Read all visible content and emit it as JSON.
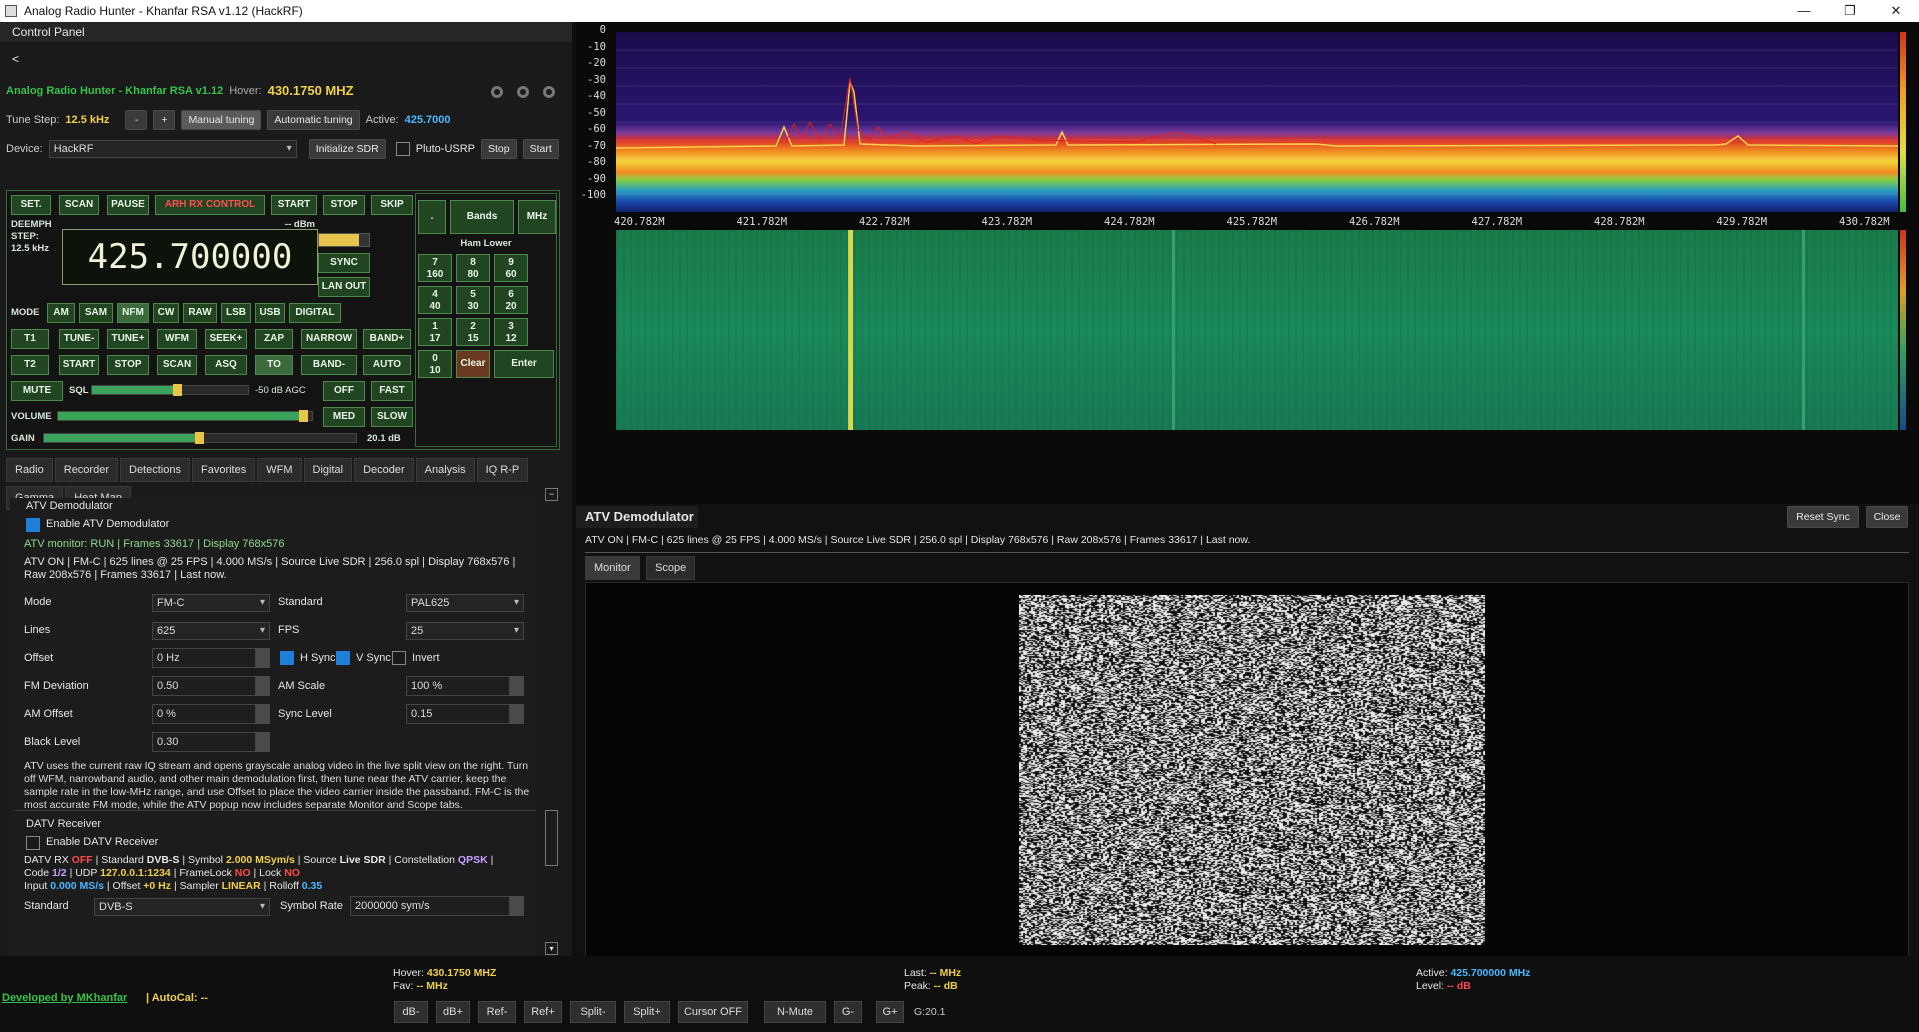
{
  "window": {
    "title": "Analog Radio Hunter - Khanfar RSA v1.12 (HackRF)",
    "minimize": "—",
    "maximize": "❐",
    "close": "✕"
  },
  "control_panel": {
    "title": "Control Panel",
    "collapse": "<",
    "app_name": "Analog Radio Hunter - Khanfar RSA v1.12",
    "hover_label": "Hover:",
    "hover_value": "430.1750 MHZ",
    "tune_step_label": "Tune Step:",
    "tune_step_value": "12.5 kHz",
    "minus": "-",
    "plus": "+",
    "manual_tuning": "Manual tuning",
    "automatic_tuning": "Automatic tuning",
    "active_label": "Active:",
    "active_value": "425.7000",
    "device_label": "Device:",
    "device_value": "HackRF",
    "init_sdr": "Initialize SDR",
    "pluto": "Pluto-USRP",
    "stop": "Stop",
    "start": "Start"
  },
  "arh": {
    "top_buttons": [
      "SET.",
      "SCAN",
      "PAUSE",
      "ARH RX CONTROL",
      "START",
      "STOP",
      "SKIP"
    ],
    "deemph": "DEEMPH",
    "step": "STEP:",
    "step_val": "12.5 kHz",
    "dbm": "-- dBm",
    "frequency": "425.700000",
    "sync": "SYNC",
    "lan_out": "LAN OUT",
    "mode_label": "MODE",
    "modes": [
      "AM",
      "SAM",
      "NFM",
      "CW",
      "RAW",
      "LSB",
      "USB",
      "DIGITAL"
    ],
    "row1": [
      "T1",
      "TUNE-",
      "TUNE+",
      "WFM",
      "SEEK+",
      "ZAP",
      "NARROW",
      "BAND+"
    ],
    "row2": [
      "T2",
      "START",
      "STOP",
      "SCAN",
      "ASQ",
      "TO",
      "BAND-",
      "AUTO"
    ],
    "mute": "MUTE",
    "sql": "SQL",
    "sql_value": "-50 dB AGC",
    "sql_level": 0.55,
    "off": "OFF",
    "fast": "FAST",
    "volume": "VOLUME",
    "volume_level": 0.97,
    "med": "MED",
    "slow": "SLOW",
    "gain": "GAIN",
    "gain_level": 0.5,
    "gain_value": "20.1 dB",
    "keypad": {
      "dot": ".",
      "bands": "Bands",
      "mhz": "MHz",
      "band_name": "Ham Lower",
      "keys": [
        [
          "7",
          "160"
        ],
        [
          "8",
          "80"
        ],
        [
          "9",
          "60"
        ],
        [
          "4",
          "40"
        ],
        [
          "5",
          "30"
        ],
        [
          "6",
          "20"
        ],
        [
          "1",
          "17"
        ],
        [
          "2",
          "15"
        ],
        [
          "3",
          "12"
        ],
        [
          "0",
          "10"
        ]
      ],
      "clear": "Clear",
      "enter": "Enter"
    }
  },
  "tabs": [
    "Radio",
    "Recorder",
    "Detections",
    "Favorites",
    "WFM",
    "Digital",
    "Decoder",
    "Analysis",
    "IQ R-P",
    "Gamma",
    "Heat Map"
  ],
  "atv_panel": {
    "group": "ATV Demodulator",
    "enable": "Enable ATV Demodulator",
    "monitor": "ATV monitor: RUN | Frames 33617 | Display 768x576",
    "status": "ATV ON | FM-C | 625 lines @ 25 FPS | 4.000 MS/s | Source Live SDR | 256.0 spl | Display 768x576 | Raw 208x576 | Frames 33617 | Last now.",
    "mode_label": "Mode",
    "mode_value": "FM-C",
    "standard_label": "Standard",
    "standard_value": "PAL625",
    "lines_label": "Lines",
    "lines_value": "625",
    "fps_label": "FPS",
    "fps_value": "25",
    "offset_label": "Offset",
    "offset_value": "0 Hz",
    "hsync": "H Sync",
    "vsync": "V Sync",
    "invert": "Invert",
    "fmdev_label": "FM Deviation",
    "fmdev_value": "0.50",
    "amscale_label": "AM Scale",
    "amscale_value": "100 %",
    "amoffset_label": "AM Offset",
    "amoffset_value": "0 %",
    "synclevel_label": "Sync Level",
    "synclevel_value": "0.15",
    "black_label": "Black Level",
    "black_value": "0.30",
    "help": "ATV uses the current raw IQ stream and opens grayscale analog video in the live split view on the right. Turn off WFM, narrowband audio, and other main demodulation first, then tune near the ATV carrier, keep the sample rate in the low-MHz range, and use Offset to place the video carrier inside the passband. FM-C is the most accurate FM mode, while the ATV popup now includes separate Monitor and Scope tabs."
  },
  "datv_panel": {
    "group": "DATV Receiver",
    "enable": "Enable DATV Receiver",
    "l1": {
      "rx": "DATV RX",
      "rx_v": "OFF",
      "std": "| Standard",
      "std_v": "DVB-S",
      "sym": "| Symbol",
      "sym_v": "2.000 MSym/s",
      "src": "| Source",
      "src_v": "Live SDR",
      "con": "| Constellation",
      "con_v": "QPSK",
      "end": "|"
    },
    "l2": {
      "code": "Code",
      "code_v": "1/2",
      "udp": "| UDP",
      "udp_v": "127.0.0.1:1234",
      "fl": "| FrameLock",
      "fl_v": "NO",
      "lk": "| Lock",
      "lk_v": "NO"
    },
    "l3": {
      "in": "Input",
      "in_v": "0.000 MS/s",
      "off": "| Offset",
      "off_v": "+0 Hz",
      "smp": "| Sampler",
      "smp_v": "LINEAR",
      "roll": "| Rolloff",
      "roll_v": "0.35"
    },
    "std_label": "Standard",
    "std_value": "DVB-S",
    "symrate_label": "Symbol Rate",
    "symrate_value": "2000000 sym/s"
  },
  "spectrum": {
    "y_ticks": [
      "0",
      "-10",
      "-20",
      "-30",
      "-40",
      "-50",
      "-60",
      "-70",
      "-80",
      "-90",
      "-100"
    ],
    "x_ticks": [
      "420.782M",
      "421.782M",
      "422.782M",
      "423.782M",
      "424.782M",
      "425.782M",
      "426.782M",
      "427.782M",
      "428.782M",
      "429.782M",
      "430.782M"
    ]
  },
  "atv_window": {
    "title": "ATV Demodulator",
    "reset_sync": "Reset Sync",
    "close": "Close",
    "status": "ATV ON | FM-C | 625 lines @ 25 FPS | 4.000 MS/s | Source Live SDR | 256.0 spl | Display 768x576 | Raw 208x576 | Frames 33617 | Last now.",
    "tab_monitor": "Monitor",
    "tab_scope": "Scope"
  },
  "footer": {
    "dev": "Developed by MKhanfar",
    "autocal": "| AutoCal: --",
    "hover_label": "Hover:",
    "hover_value": "430.1750 MHZ",
    "fav_label": "Fav:",
    "fav_value": "-- MHz",
    "last_label": "Last:",
    "last_value": "-- MHz",
    "peak_label": "Peak:",
    "peak_value": "-- dB",
    "active_label": "Active:",
    "active_value": "425.700000 MHz",
    "level_label": "Level:",
    "level_value": "-- dB",
    "buttons": [
      "dB-",
      "dB+",
      "Ref-",
      "Ref+",
      "Split-",
      "Split+",
      "Cursor OFF",
      "N-Mute",
      "G-",
      "G+"
    ],
    "g_value": "G:20.1"
  }
}
